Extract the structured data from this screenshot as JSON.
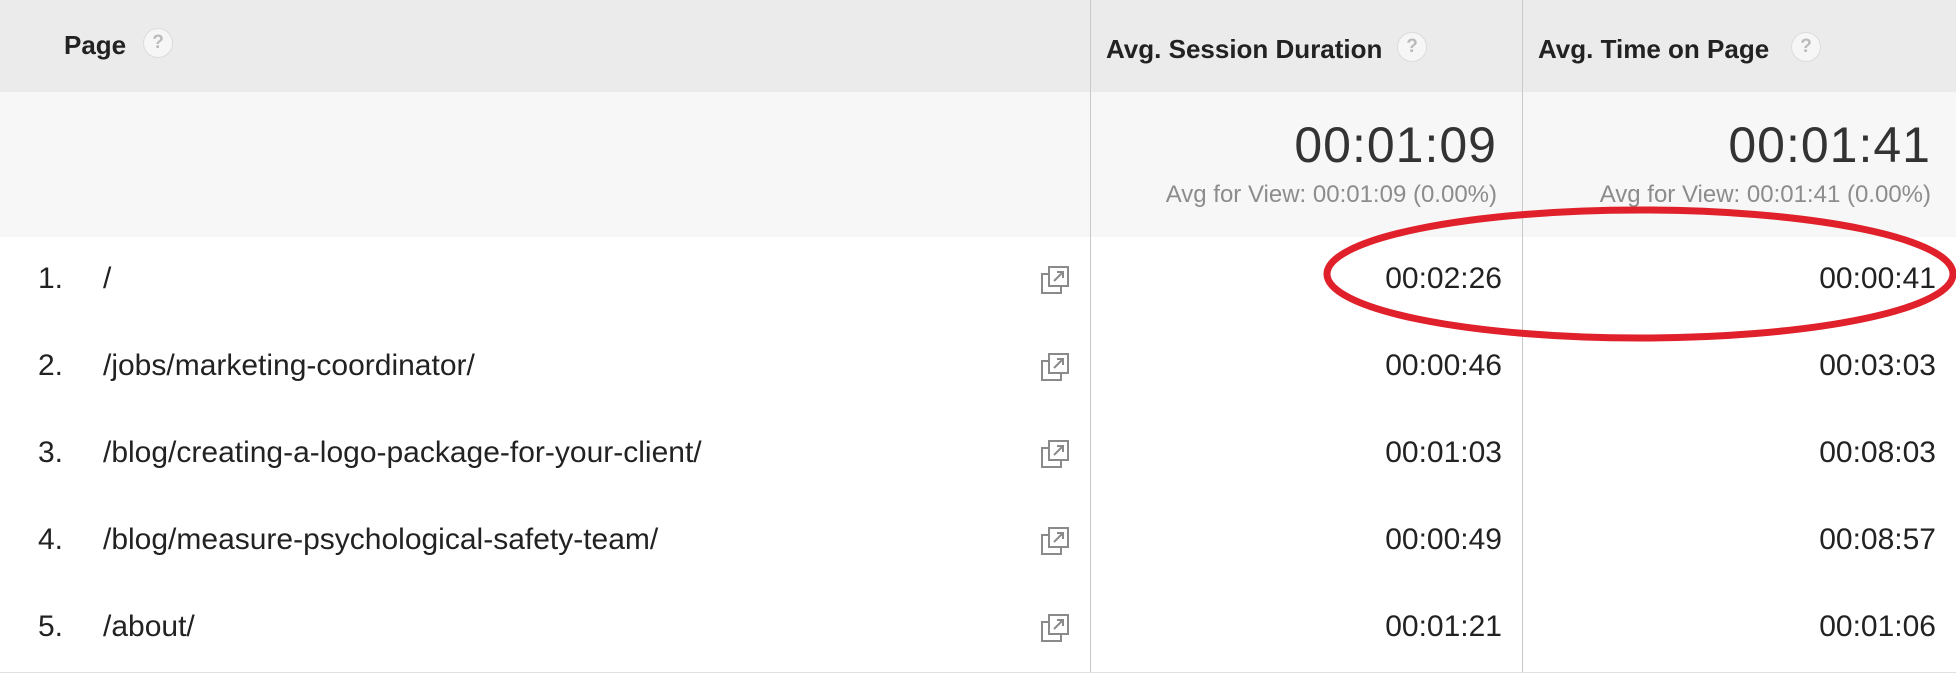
{
  "columns": {
    "page": "Page",
    "session": "Avg. Session Duration",
    "top": "Avg. Time on Page",
    "help_icon": "question-mark-icon"
  },
  "summary": {
    "session": {
      "value": "00:01:09",
      "sub": "Avg for View: 00:01:09 (0.00%)"
    },
    "top": {
      "value": "00:01:41",
      "sub": "Avg for View: 00:01:41 (0.00%)"
    }
  },
  "rows": [
    {
      "index": "1.",
      "page": "/",
      "session": "00:02:26",
      "top": "00:00:41"
    },
    {
      "index": "2.",
      "page": "/jobs/marketing-coordinator/",
      "session": "00:00:46",
      "top": "00:03:03"
    },
    {
      "index": "3.",
      "page": "/blog/creating-a-logo-package-for-your-client/",
      "session": "00:01:03",
      "top": "00:08:03"
    },
    {
      "index": "4.",
      "page": "/blog/measure-psychological-safety-team/",
      "session": "00:00:49",
      "top": "00:08:57"
    },
    {
      "index": "5.",
      "page": "/about/",
      "session": "00:01:21",
      "top": "00:01:06"
    }
  ],
  "row_icon": "open-in-new-window-icon",
  "annotation": {
    "shape": "ellipse",
    "color": "#e0202a"
  }
}
